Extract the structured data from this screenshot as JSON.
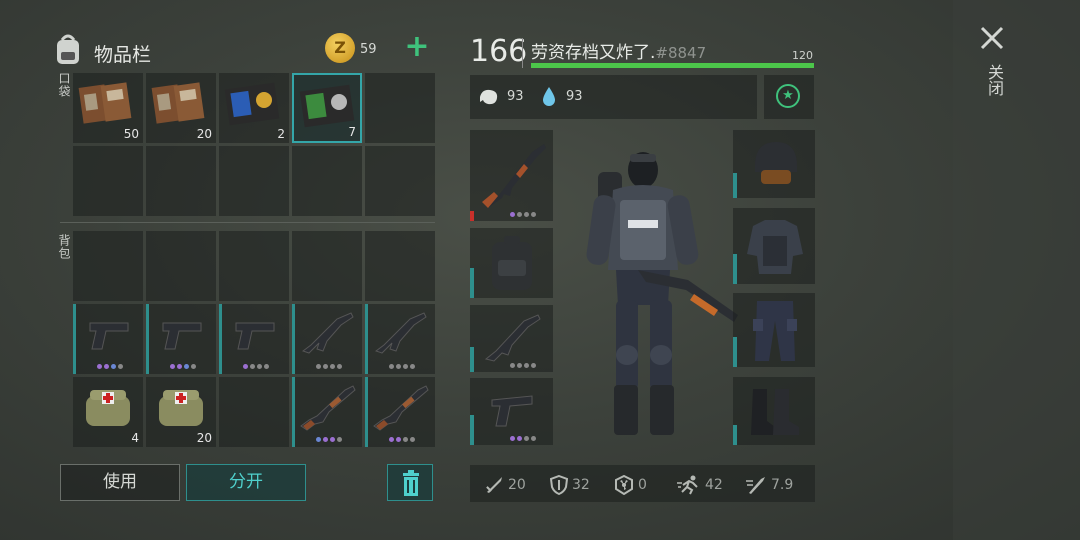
{
  "inventory": {
    "title": "物品栏",
    "coins": "59",
    "pockets_label": "口袋",
    "backpack_label": "背包",
    "pocket_items": [
      {
        "name": "document-folder",
        "count": "50",
        "colors": [
          "#8a5a36",
          "#7c4e2f"
        ]
      },
      {
        "name": "document-folder",
        "count": "20",
        "colors": [
          "#8a5a36",
          "#7c4e2f"
        ]
      },
      {
        "name": "police-badge-wallet-blue",
        "count": "2",
        "colors": [
          "#2b5db5",
          "#d4a431"
        ]
      },
      {
        "name": "police-badge-wallet-green",
        "count": "7",
        "colors": [
          "#3c8b3e",
          "#b7b7b7"
        ]
      }
    ],
    "backpack_counts": {
      "medkit1": "4",
      "medkit2": "20"
    },
    "use_label": "使用",
    "split_label": "分开"
  },
  "character": {
    "level": "166",
    "name": "劳资存档又炸了.",
    "tag": "#8847",
    "xp_max": "120",
    "hunger": "93",
    "thirst": "93"
  },
  "stats": {
    "attack": "20",
    "defense": "32",
    "radiation": "0",
    "speed": "42",
    "weight": "7.9"
  },
  "close_label": "关闭",
  "colors": {
    "accent": "#2e8f8d",
    "xp_bar": "#4cc64a",
    "coin": "#d9a62a"
  }
}
